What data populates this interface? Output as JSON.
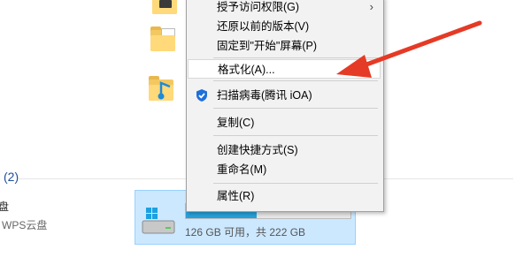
{
  "explorer": {
    "section_header": "(2)",
    "left_label": "盘",
    "left_sublabel": "WPS云盘",
    "drive": {
      "space_text": "126 GB 可用，共 222 GB",
      "used_fraction": 0.43
    }
  },
  "context_menu": {
    "items": [
      {
        "label": "授予访问权限(G)"
      },
      {
        "label": "还原以前的版本(V)"
      },
      {
        "label": "固定到\"开始\"屏幕(P)"
      },
      {
        "label": "格式化(A)..."
      },
      {
        "label": "扫描病毒(腾讯 iOA)"
      },
      {
        "label": "复制(C)"
      },
      {
        "label": "创建快捷方式(S)"
      },
      {
        "label": "重命名(M)"
      },
      {
        "label": "属性(R)"
      }
    ]
  },
  "colors": {
    "annotation_arrow": "#e53a25",
    "drive_fill": "#26a0da",
    "selection_bg": "#cce8ff"
  },
  "icons": {
    "folders": [
      "video-folder-icon",
      "documents-folder-icon",
      "music-folder-icon"
    ],
    "drive": "windows-drive-icon",
    "scan": "tencent-ioa-shield-icon"
  }
}
